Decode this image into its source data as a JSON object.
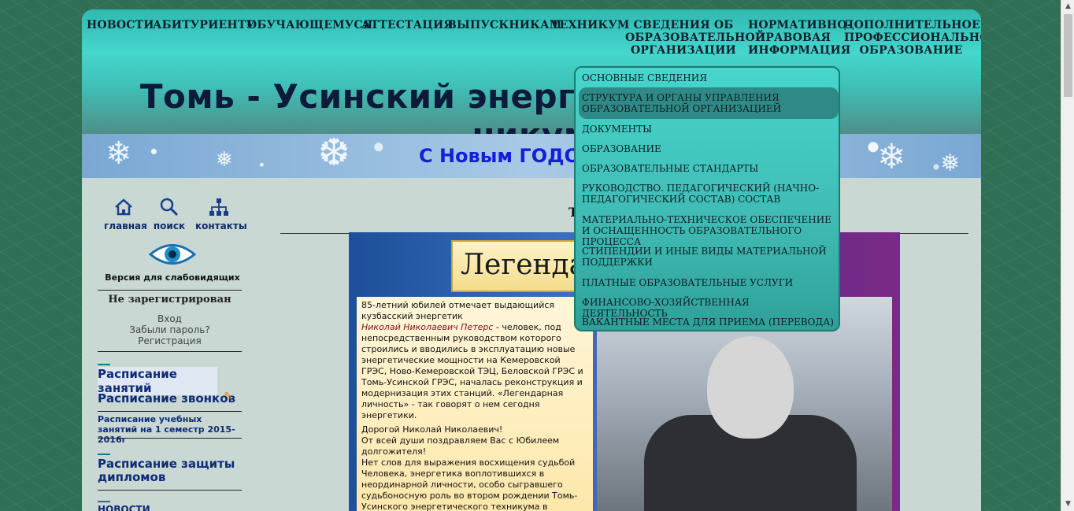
{
  "nav": {
    "items": [
      {
        "label": "НОВОСТИ"
      },
      {
        "label": "АБИТУРИЕНТУ"
      },
      {
        "label": "ОБУЧАЮЩЕМУСЯ"
      },
      {
        "label": "АТТЕСТАЦИЯ"
      },
      {
        "label": "ВЫПУСКНИКАМ"
      },
      {
        "label": "ТЕХНИКУМ"
      },
      {
        "label": "СВЕДЕНИЯ ОБ ОБРАЗОВАТЕЛЬНОЙ ОРГАНИЗАЦИИ"
      },
      {
        "label": "НОРМАТИВНО-ПРАВОВАЯ ИНФОРМАЦИЯ"
      },
      {
        "label": "ДОПОЛНИТЕЛЬНОЕ ПРОФЕССИОНАЛЬНОЕ ОБРАЗОВАНИЕ"
      }
    ]
  },
  "site_title": "Томь - Усинский энерготра",
  "site_title_tail": "никум",
  "banner_text": "С Новым ГОДО",
  "quick_links": [
    {
      "label": "главная",
      "icon": "home-icon"
    },
    {
      "label": "поиск",
      "icon": "search-icon"
    },
    {
      "label": "контакты",
      "icon": "sitemap-icon"
    }
  ],
  "accessibility_label": "Версия для слабовидящих",
  "login": {
    "status": "Не зарегистрирован",
    "login_link": "Вход",
    "forgot_link": "Забыли пароль?",
    "register_link": "Регистрация"
  },
  "side_links": [
    {
      "label": "Расписание   занятий"
    },
    {
      "label": "Расписание звонков"
    },
    {
      "label": "Расписание учебных занятий на 1 семестр 2015-2016г"
    },
    {
      "label": "Расписание защиты дипломов"
    },
    {
      "label": "НОВОСТИ"
    }
  ],
  "main_title_fragment": "Т",
  "poster": {
    "heading": "Легендар",
    "intro_line": "85-летний юбилей отмечает выдающийся кузбасский энергетик",
    "name": "Николай Николаевич Петерс",
    "bio": " - человек, под непосредственным руководством которого строились и вводились в эксплуатацию новые энергетические мощности на Кемеровской ГРЭС, Ново-Кемеровской ТЭЦ, Беловской ГРЭС и Томь-Усинской ГРЭС, началась реконструкция и модернизация этих станций. «Легендарная личность» - так говорят о нем сегодня энергетики.",
    "greeting": "Дорогой Николай Николаевич!",
    "congrats": "От всей души поздравляем Вас с Юбилеем долгожителя!",
    "body": "Нет слов для выражения восхищения судьбой Человека, энергетика воплотившихся в неординарной личности, особо сыгравшего судьбоносную роль во втором рождении Томь-Усинского энергетического техникума в"
  },
  "dropdown": {
    "items": [
      {
        "label": "ОСНОВНЫЕ СВЕДЕНИЯ"
      },
      {
        "label": "СТРУКТУРА И ОРГАНЫ УПРАВЛЕНИЯ ОБРАЗОВАТЕЛЬНОЙ ОРГАНИЗАЦИЕЙ"
      },
      {
        "label": "ДОКУМЕНТЫ"
      },
      {
        "label": "ОБРАЗОВАНИЕ"
      },
      {
        "label": "ОБРАЗОВАТЕЛЬНЫЕ СТАНДАРТЫ"
      },
      {
        "label": "РУКОВОДСТВО. ПЕДАГОГИЧЕСКИЙ (НАЧНО-ПЕДАГОГИЧЕСКИЙ СОСТАВ) СОСТАВ"
      },
      {
        "label": "МАТЕРИАЛЬНО-ТЕХНИЧЕСКОЕ ОБЕСПЕЧЕНИЕ И ОСНАЩЕННОСТЬ ОБРАЗОВАТЕЛЬНОГО ПРОЦЕССА"
      },
      {
        "label": "СТИПЕНДИИ И ИНЫЕ ВИДЫ МАТЕРИАЛЬНОЙ ПОДДЕРЖКИ"
      },
      {
        "label": "ПЛАТНЫЕ ОБРАЗОВАТЕЛЬНЫЕ УСЛУГИ"
      },
      {
        "label": "ФИНАНСОВО-ХОЗЯЙСТВЕННАЯ ДЕЯТЕЛЬНОСТЬ"
      },
      {
        "label": "ВАКАНТНЫЕ МЕСТА ДЛЯ ПРИЕМА (ПЕРЕВОДА)"
      }
    ]
  },
  "colors": {
    "header_teal": "#45d6cd",
    "page_bg": "#c9d8d3",
    "banner_text": "#1320d8",
    "link_blue": "#0d2a78"
  }
}
